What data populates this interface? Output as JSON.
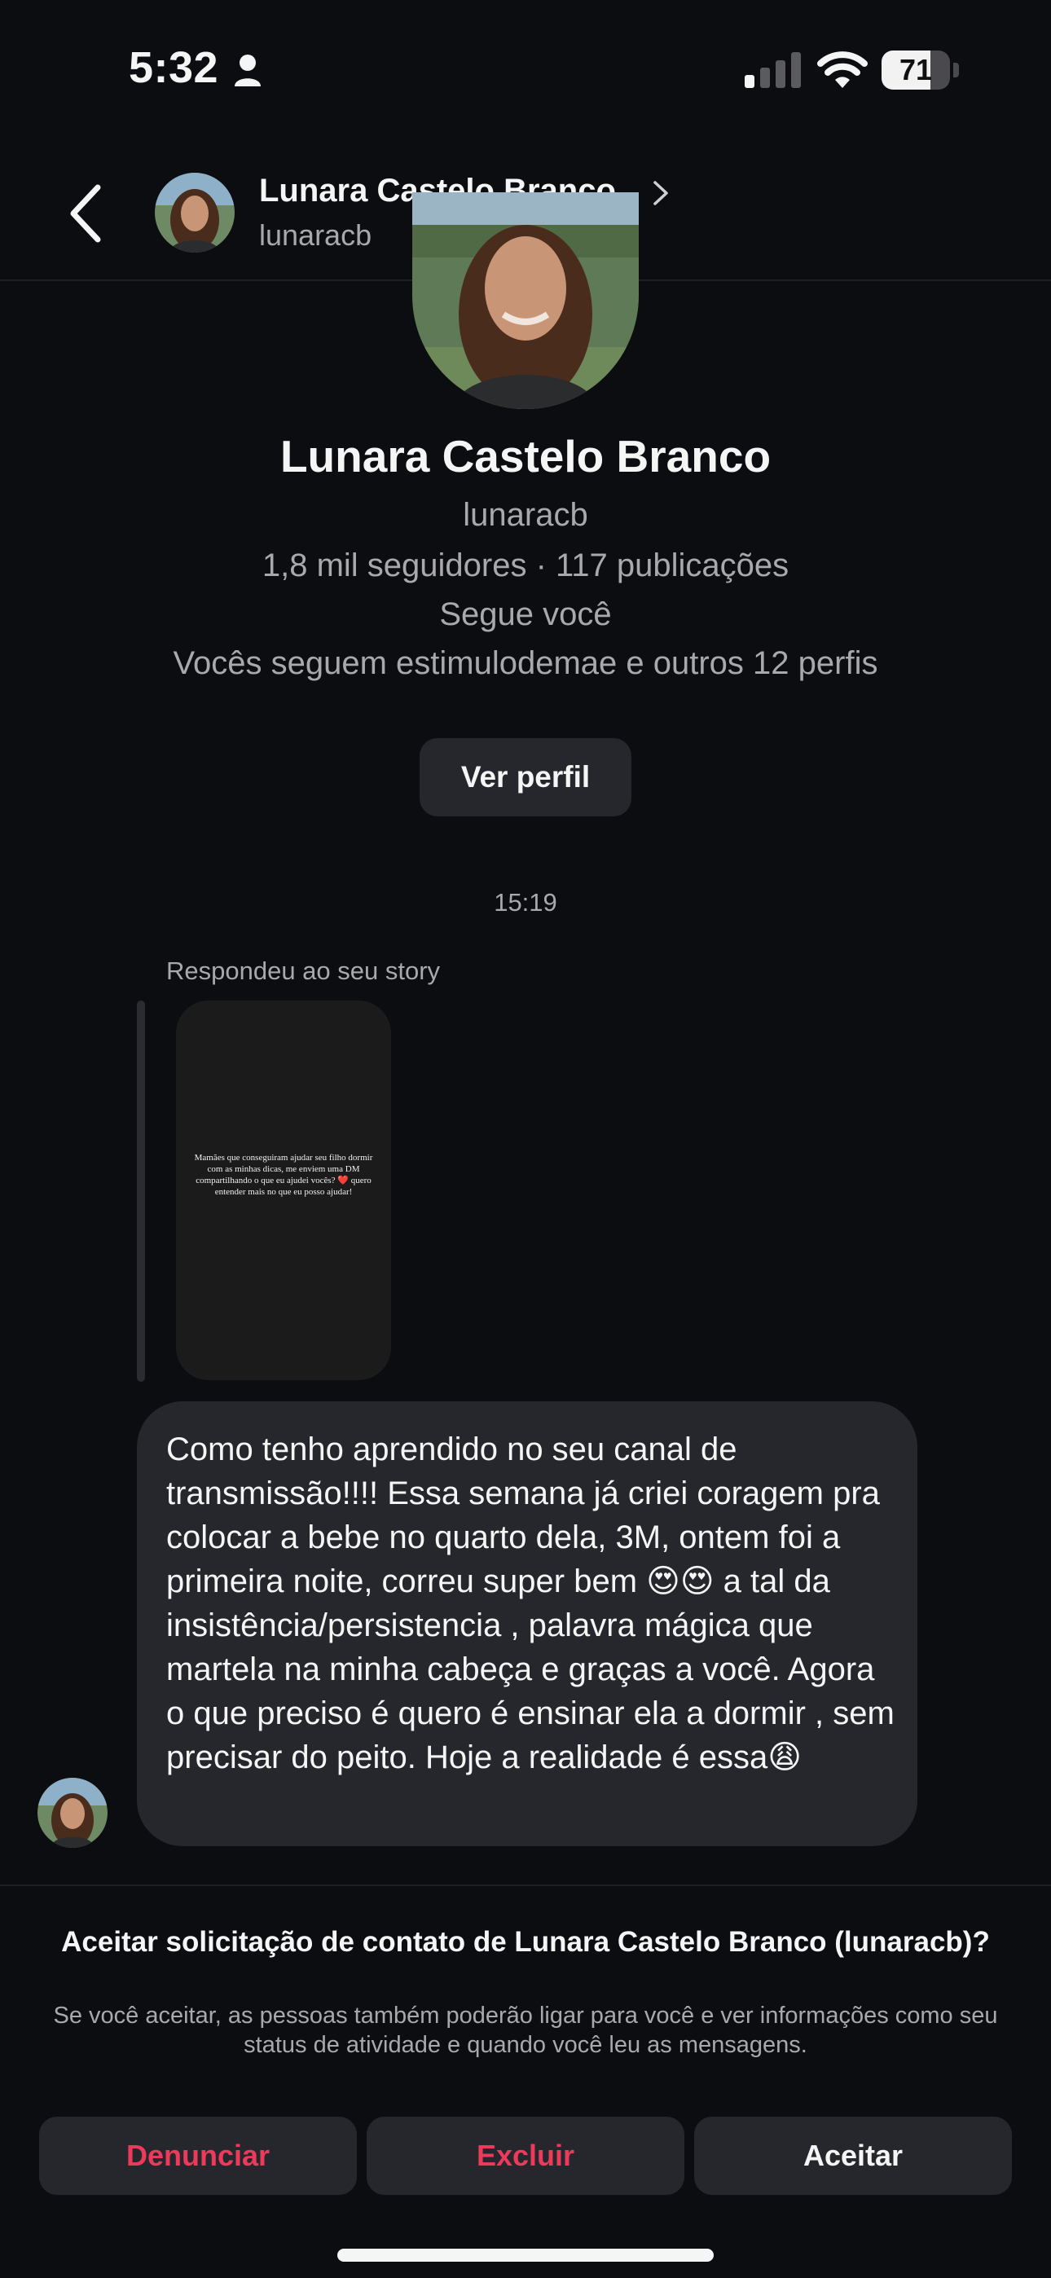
{
  "status_bar": {
    "time": "5:32",
    "battery_level": "71",
    "battery_fraction": 0.71
  },
  "header": {
    "display_name": "Lunara Castelo Branco",
    "username": "lunaracb"
  },
  "profile": {
    "name": "Lunara Castelo Branco",
    "username": "lunaracb",
    "stats": "1,8 mil seguidores · 117 publicações",
    "follows_you": "Segue você",
    "mutuals": "Vocês seguem estimulodemae e outros 12 perfis",
    "view_profile_label": "Ver perfil"
  },
  "conversation": {
    "timestamp": "15:19",
    "reply_label": "Respondeu ao seu story",
    "story_text": "Mamães que conseguiram ajudar seu filho dormir com as minhas dicas, me enviem uma DM compartilhando o que eu ajudei vocês? ❤️ quero entender mais no que eu posso ajudar!",
    "message": "Como tenho aprendido no seu canal de transmissão!!!! Essa semana já criei coragem pra colocar a bebe no quarto dela, 3M, ontem foi a primeira noite, correu super bem 😍😍 a tal da insistência/persistencia , palavra mágica que martela na minha cabeça e graças a você. Agora o que preciso é quero é ensinar ela a dormir , sem precisar do peito. Hoje a realidade é essa😩"
  },
  "request": {
    "title": "Aceitar solicitação de contato de Lunara Castelo Branco (lunaracb)?",
    "subtitle": "Se você aceitar, as pessoas também poderão ligar para você e ver informações como seu status de atividade e quando você leu as mensagens.",
    "report_label": "Denunciar",
    "delete_label": "Excluir",
    "accept_label": "Aceitar"
  },
  "colors": {
    "background": "#0b0d11",
    "surface": "#25272c",
    "secondary_text": "#a8a8ad",
    "danger": "#ec3a5c"
  },
  "icons": [
    "person-icon",
    "signal-icon",
    "wifi-icon",
    "battery-icon",
    "back-chevron-icon",
    "chevron-right-icon"
  ]
}
